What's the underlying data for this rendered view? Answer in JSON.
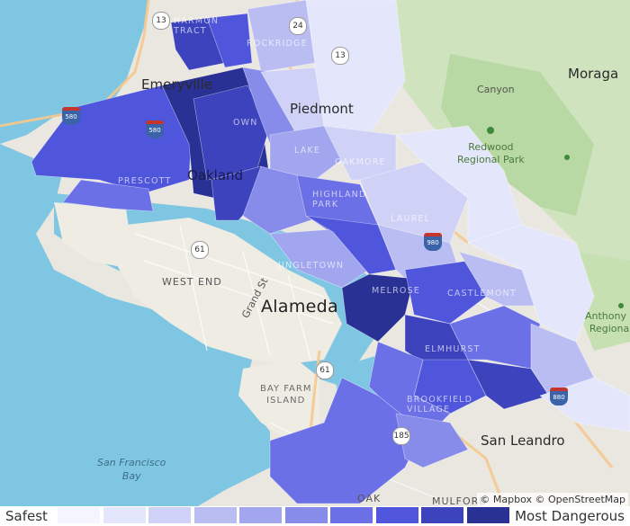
{
  "map": {
    "attribution": "© Mapbox © OpenStreetMap",
    "places": {
      "emeryville": "Emeryville",
      "piedmont": "Piedmont",
      "oakland": "Oakland",
      "alameda": "Alameda",
      "moraga": "Moraga",
      "canyon": "Canyon",
      "san_leandro": "San Leandro",
      "redwood_park": "Redwood\nRegional Park",
      "anthony_park": "Anthony C\nRegional",
      "sf_bay": "San Francisco\nBay",
      "bay_farm": "BAY FARM\nISLAND",
      "west_end": "WEST END",
      "grand_st": "Grand St",
      "harmon_tract": "HARMON\nTRACT",
      "rockridge": "ROCKRIDGE",
      "oakmore": "OAKMORE",
      "lake": "LAKE",
      "highland_park": "HIGHLAND\nPARK",
      "laurel": "LAUREL",
      "jingletown": "JINGLETOWN",
      "melrose": "MELROSE",
      "castlemont": "CASTLEMONT",
      "elmhurst": "ELMHURST",
      "brookfield_village": "BROOKFIELD\nVILLAGE",
      "prescott": "PRESCOTT",
      "oak": "OAK",
      "mulford": "MULFORD",
      "downtown": "OWN"
    },
    "shields": {
      "ca13": "13",
      "ca24": "24",
      "i13": "13",
      "i580": "580",
      "ca61a": "61",
      "ca61b": "61",
      "i880": "880",
      "i980": "980",
      "i580b": "580",
      "ca185": "185"
    }
  },
  "legend": {
    "safest_label": "Safest",
    "dangerous_label": "Most Dangerous",
    "colors": [
      "#f4f5fe",
      "#e4e6fb",
      "#cfd2f6",
      "#b9bdf2",
      "#a1a6ee",
      "#878cea",
      "#6c70e6",
      "#4f56dc",
      "#3c43bc",
      "#2a3194"
    ]
  }
}
